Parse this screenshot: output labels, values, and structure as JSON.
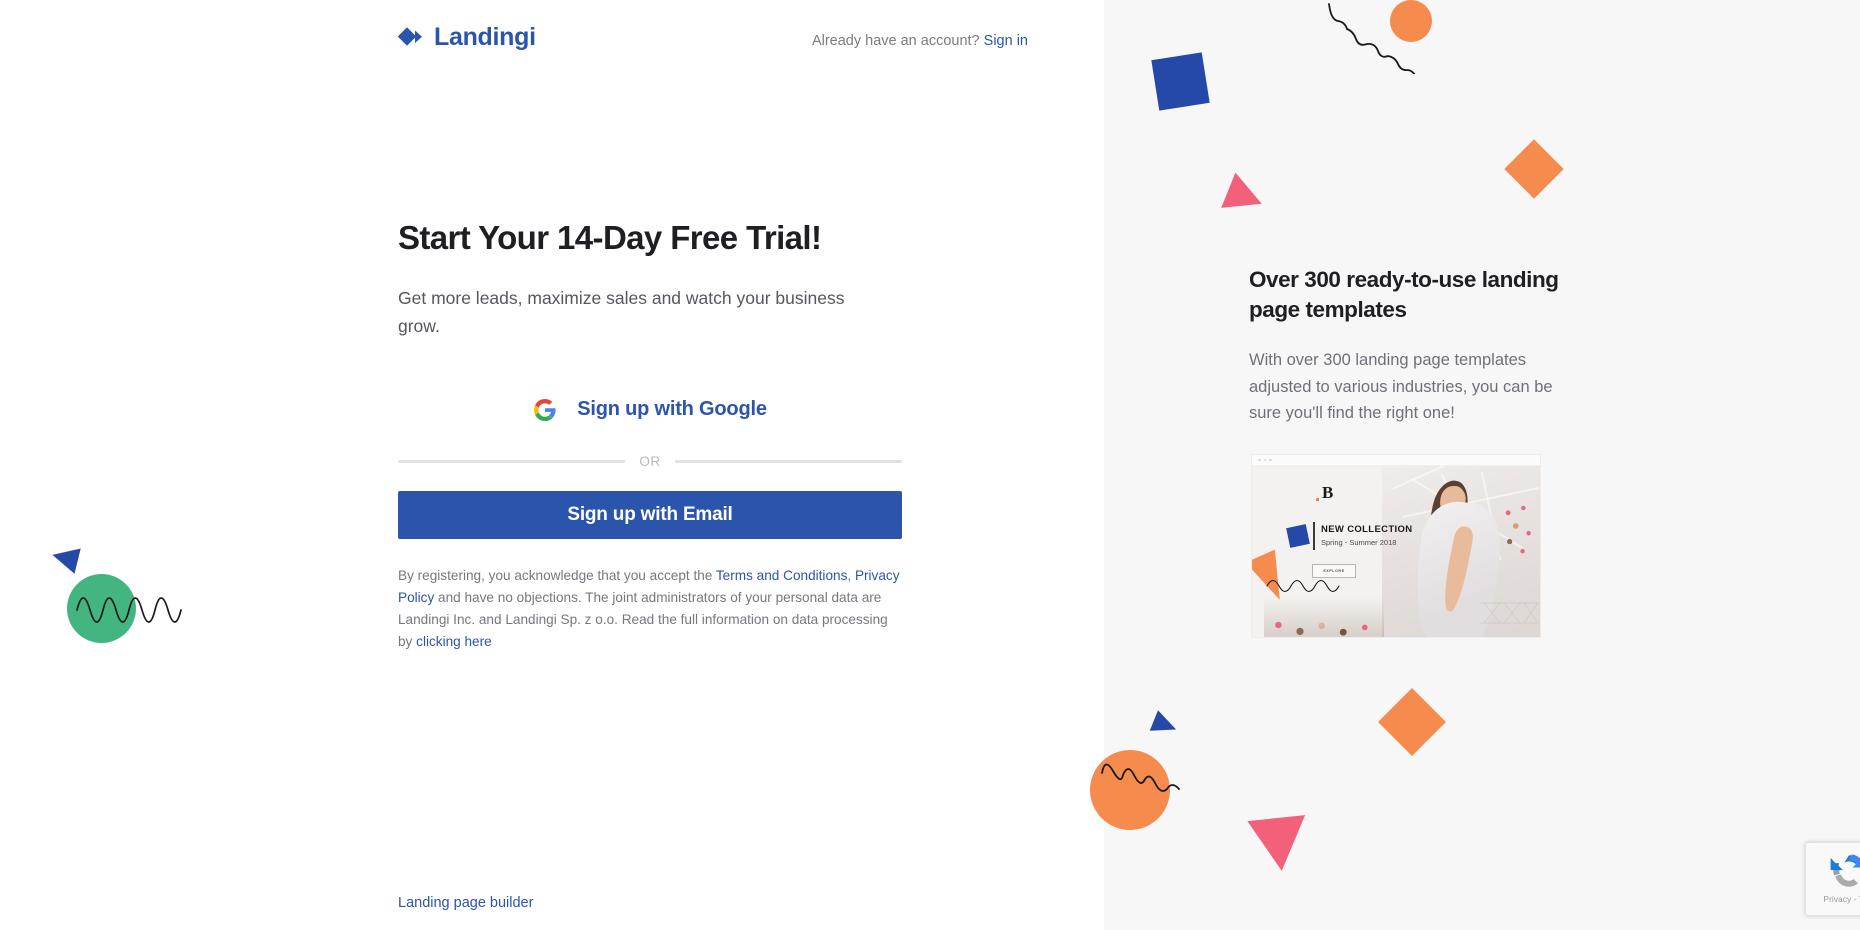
{
  "brand": {
    "name": "Landingi",
    "mark": "landingi-diamond-logo"
  },
  "header": {
    "account_prompt": "Already have an account?",
    "signin_label": "Sign in"
  },
  "main": {
    "title": "Start Your 14-Day Free Trial!",
    "subtitle": "Get more leads, maximize sales and watch your business grow.",
    "google_button": "Sign up with Google",
    "divider_label": "OR",
    "email_button": "Sign up with Email",
    "legal": {
      "part1": "By registering, you acknowledge that you accept the ",
      "link_terms": "Terms and Conditions",
      "part2": ", ",
      "link_privacy": "Privacy Policy",
      "part3": " and have no objections. The joint administrators of your personal data are Landingi Inc. and Landingi Sp. z o.o. Read the full information on data processing by ",
      "link_here": "clicking here"
    }
  },
  "footer": {
    "link_label": "Landing page builder"
  },
  "promo": {
    "title": "Over 300 ready-to-use landing page templates",
    "text": "With over 300 landing page templates adjusted to various industries, you can be sure you'll find the right one!",
    "template_preview": {
      "brand_mark": "B",
      "headline": "NEW COLLECTION",
      "subline": "Spring - Summer 2018",
      "cta": "EXPLORE"
    }
  },
  "recaptcha": {
    "label": "Privacy - Term",
    "icon": "recaptcha-icon"
  },
  "colors": {
    "brand_blue": "#2B55AC",
    "deep_blue": "#2549A8",
    "orange": "#F68B4E",
    "pink": "#F2607A",
    "green": "#43B581",
    "panel_bg": "#F7F7F8",
    "heading": "#1F1F23",
    "body_text": "#6F6F78"
  }
}
